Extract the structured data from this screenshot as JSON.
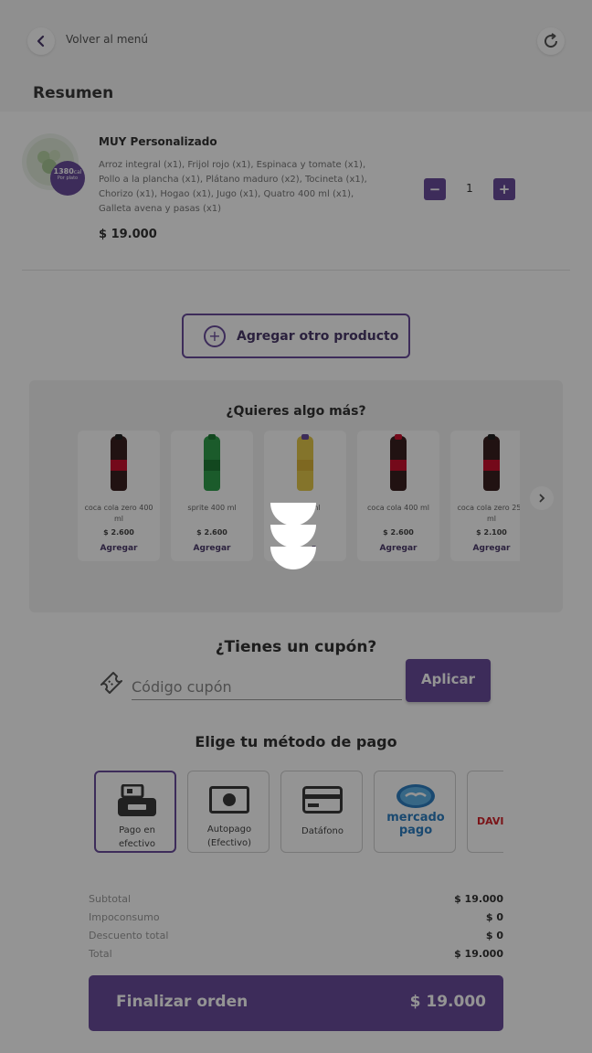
{
  "header": {
    "back_label": "Volver al menú",
    "title": "Resumen"
  },
  "cart": {
    "item": {
      "name": "MUY Personalizado",
      "kcal": "1380",
      "kcal_unit": "cal",
      "kcal_sub": "Por plato",
      "description": "Arroz integral (x1), Frijol rojo (x1), Espinaca y tomate (x1), Pollo a la plancha (x1), Plátano maduro (x2), Tocineta (x1), Chorizo (x1), Hogao (x1), Jugo (x1), Quatro 400 ml (x1), Galleta avena y pasas (x1)",
      "price": "$ 19.000",
      "quantity": "1",
      "minus": "−",
      "plus": "+"
    }
  },
  "add_product": {
    "label": "Agregar otro producto"
  },
  "upsell": {
    "title": "¿Quieres algo más?",
    "items": [
      {
        "name": "coca cola zero 400 ml",
        "price": "$ 2.600",
        "action": "Agregar",
        "color": "#3a1f1f",
        "label_color": "#c8102e"
      },
      {
        "name": "sprite 400 ml",
        "price": "$ 2.600",
        "action": "Agregar",
        "color": "#2f9e4a",
        "label_color": "#1f7a36"
      },
      {
        "name": "0 ml",
        "price": "0",
        "action": "r",
        "color": "#e3c84a",
        "label_color": "#6a4c9c"
      },
      {
        "name": "coca cola 400 ml",
        "price": "$ 2.600",
        "action": "Agregar",
        "color": "#3a1f1f",
        "label_color": "#c8102e"
      },
      {
        "name": "coca cola zero 250 ml",
        "price": "$ 2.100",
        "action": "Agregar",
        "color": "#3a1f1f",
        "label_color": "#c8102e"
      }
    ]
  },
  "coupon": {
    "title": "¿Tienes un cupón?",
    "placeholder": "Código cupón",
    "apply_label": "Aplicar"
  },
  "payment": {
    "title": "Elige tu método de pago",
    "methods": [
      {
        "label": "Pago en efectivo",
        "icon": "cash-register-icon",
        "selected": true
      },
      {
        "label": "Autopago (Efectivo)",
        "icon": "cash-bill-icon",
        "selected": false
      },
      {
        "label": "Datáfono",
        "icon": "card-icon",
        "selected": false
      },
      {
        "label": "mercado pago",
        "icon": "mercadopago-logo",
        "selected": false
      },
      {
        "label": "DAVI",
        "icon": "davivienda-logo",
        "selected": false
      }
    ]
  },
  "totals": {
    "rows": [
      {
        "label": "Subtotal",
        "value": "$ 19.000"
      },
      {
        "label": "Impoconsumo",
        "value": "$ 0"
      },
      {
        "label": "Descuento total",
        "value": "$ 0"
      },
      {
        "label": "Total",
        "value": "$ 19.000"
      }
    ]
  },
  "checkout": {
    "label": "Finalizar orden",
    "amount": "$ 19.000"
  },
  "colors": {
    "accent": "#6a4c9c",
    "overlay": "rgba(0,0,0,0.42)"
  }
}
